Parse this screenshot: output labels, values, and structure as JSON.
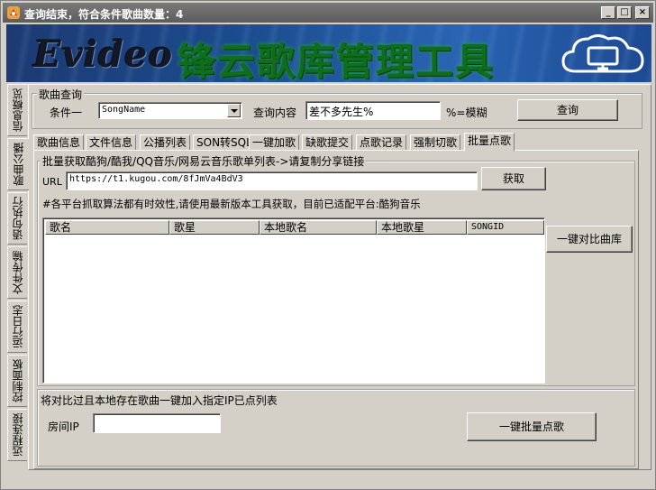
{
  "window": {
    "title": "查询结束，符合条件歌曲数量：4",
    "minimize_glyph": "_",
    "maximize_glyph": "□",
    "close_glyph": "×"
  },
  "banner": {
    "logo_text": "Evideo",
    "product_text": "锋云歌库管理工具"
  },
  "side_tabs": [
    {
      "label": "信息概览"
    },
    {
      "label": "歌曲公播"
    },
    {
      "label": "语句执行"
    },
    {
      "label": "文件传输"
    },
    {
      "label": "运行日志"
    },
    {
      "label": "控制面板"
    },
    {
      "label": "远程连接"
    }
  ],
  "query": {
    "group_label": "歌曲查询",
    "condition_label": "条件一",
    "condition_value": "SongName",
    "content_label": "查询内容",
    "content_value": "差不多先生%",
    "hint": "%=模糊",
    "query_button": "查询"
  },
  "tabs": [
    {
      "label": "歌曲信息"
    },
    {
      "label": "文件信息"
    },
    {
      "label": "公播列表"
    },
    {
      "label": "SON转SQL"
    },
    {
      "label": "一键加歌"
    },
    {
      "label": "缺歌提交"
    },
    {
      "label": "点歌记录"
    },
    {
      "label": "强制切歌"
    },
    {
      "label": "批量点歌"
    }
  ],
  "batch": {
    "fetch_group_label": "批量获取酷狗/酷我/QQ音乐/网易云音乐歌单列表->请复制分享链接",
    "url_label": "URL",
    "url_value": "https://t1.kugou.com/8fJmVa4BdV3",
    "fetch_button": "获取",
    "note": "#各平台抓取算法都有时效性,请使用最新版本工具获取，目前已适配平台:酷狗音乐",
    "columns": [
      "歌名",
      "歌星",
      "本地歌名",
      "本地歌星",
      "SONGID"
    ],
    "rows": [],
    "compare_button": "一键对比曲库",
    "add_group_label": "将对比过且本地存在歌曲一键加入指定IP已点列表",
    "room_ip_label": "房间IP",
    "room_ip_value": "",
    "batch_order_button": "一键批量点歌"
  }
}
